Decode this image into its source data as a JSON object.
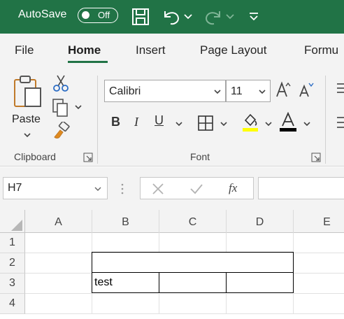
{
  "titlebar": {
    "autosave_label": "AutoSave",
    "autosave_state": "Off"
  },
  "tabs": [
    {
      "label": "File",
      "active": false
    },
    {
      "label": "Home",
      "active": true
    },
    {
      "label": "Insert",
      "active": false
    },
    {
      "label": "Page Layout",
      "active": false
    },
    {
      "label": "Formu",
      "active": false
    }
  ],
  "ribbon": {
    "clipboard": {
      "paste_label": "Paste",
      "group_label": "Clipboard"
    },
    "font": {
      "font_name": "Calibri",
      "font_size": "11",
      "group_label": "Font",
      "highlight_color": "#ffff00",
      "font_color": "#000000"
    }
  },
  "formula_bar": {
    "name_box": "H7",
    "fx_label": "fx",
    "formula": ""
  },
  "grid": {
    "columns": [
      "A",
      "B",
      "C",
      "D",
      "E"
    ],
    "rows": [
      "1",
      "2",
      "3",
      "4"
    ],
    "cells": {
      "B3": "test"
    }
  },
  "colors": {
    "accent": "#217346"
  }
}
